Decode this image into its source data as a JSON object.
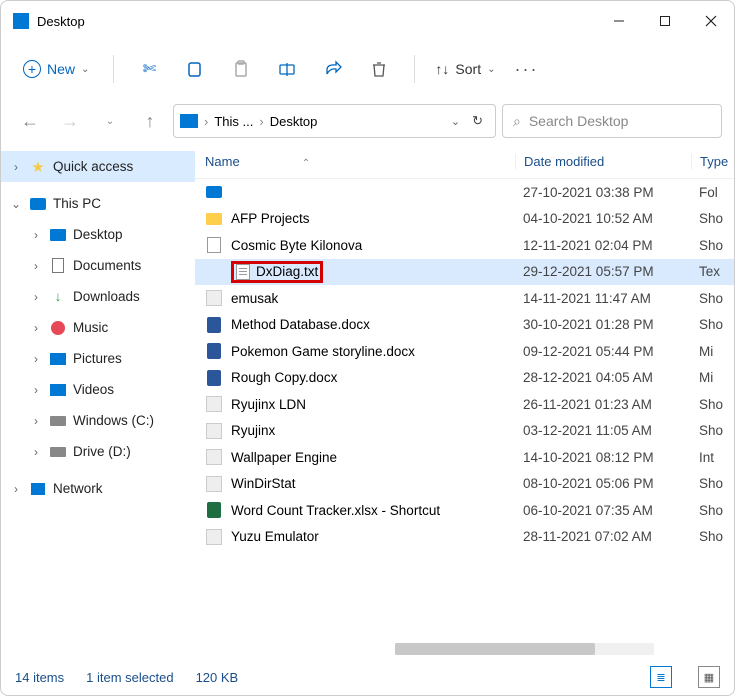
{
  "window": {
    "title": "Desktop"
  },
  "toolbar": {
    "new": "New",
    "sort": "Sort"
  },
  "breadcrumb": {
    "seg1": "This ...",
    "seg2": "Desktop"
  },
  "search": {
    "placeholder": "Search Desktop"
  },
  "sidebar": {
    "quick_access": "Quick access",
    "this_pc": "This PC",
    "items": [
      {
        "label": "Desktop"
      },
      {
        "label": "Documents"
      },
      {
        "label": "Downloads"
      },
      {
        "label": "Music"
      },
      {
        "label": "Pictures"
      },
      {
        "label": "Videos"
      },
      {
        "label": "Windows (C:)"
      },
      {
        "label": "Drive (D:)"
      }
    ],
    "network": "Network"
  },
  "columns": {
    "name": "Name",
    "date": "Date modified",
    "type": "Type"
  },
  "files": [
    {
      "name": "",
      "date": "27-10-2021 03:38 PM",
      "type": "Fol",
      "icon": "desktop"
    },
    {
      "name": "AFP Projects",
      "date": "04-10-2021 10:52 AM",
      "type": "Sho",
      "icon": "folder"
    },
    {
      "name": "Cosmic Byte Kilonova",
      "date": "12-11-2021 02:04 PM",
      "type": "Sho",
      "icon": "generic"
    },
    {
      "name": "DxDiag.txt",
      "date": "29-12-2021 05:57 PM",
      "type": "Tex",
      "icon": "txt",
      "selected": true,
      "highlight": true
    },
    {
      "name": "emusak",
      "date": "14-11-2021 11:47 AM",
      "type": "Sho",
      "icon": "shortcut"
    },
    {
      "name": "Method Database.docx",
      "date": "30-10-2021 01:28 PM",
      "type": "Sho",
      "icon": "word"
    },
    {
      "name": "Pokemon Game storyline.docx",
      "date": "09-12-2021 05:44 PM",
      "type": "Mi",
      "icon": "word"
    },
    {
      "name": "Rough Copy.docx",
      "date": "28-12-2021 04:05 AM",
      "type": "Mi",
      "icon": "word"
    },
    {
      "name": "Ryujinx LDN",
      "date": "26-11-2021 01:23 AM",
      "type": "Sho",
      "icon": "shortcut"
    },
    {
      "name": "Ryujinx",
      "date": "03-12-2021 11:05 AM",
      "type": "Sho",
      "icon": "shortcut"
    },
    {
      "name": "Wallpaper Engine",
      "date": "14-10-2021 08:12 PM",
      "type": "Int",
      "icon": "shortcut"
    },
    {
      "name": "WinDirStat",
      "date": "08-10-2021 05:06 PM",
      "type": "Sho",
      "icon": "shortcut"
    },
    {
      "name": "Word Count Tracker.xlsx - Shortcut",
      "date": "06-10-2021 07:35 AM",
      "type": "Sho",
      "icon": "excel"
    },
    {
      "name": "Yuzu Emulator",
      "date": "28-11-2021 07:02 AM",
      "type": "Sho",
      "icon": "shortcut"
    }
  ],
  "status": {
    "count": "14 items",
    "selected": "1 item selected",
    "size": "120 KB"
  }
}
